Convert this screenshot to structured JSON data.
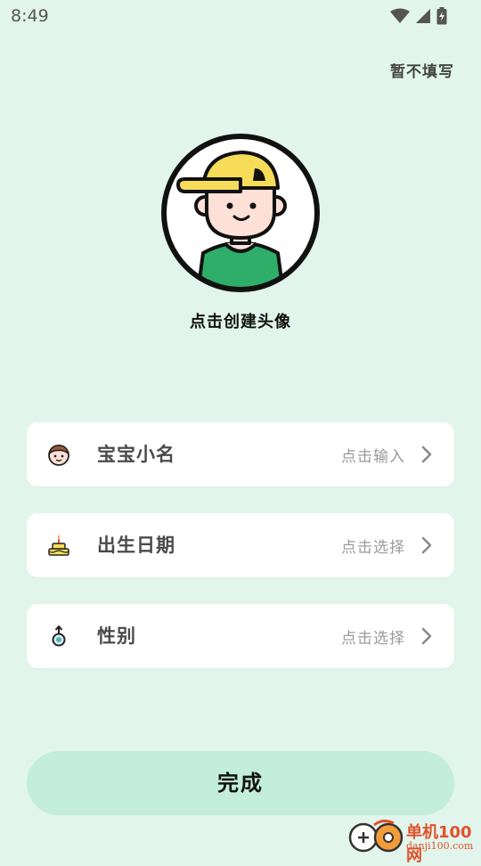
{
  "status_bar": {
    "time": "8:49",
    "icons": [
      "wifi-icon",
      "cell-signal-icon",
      "battery-charging-icon"
    ]
  },
  "header": {
    "skip_label": "暂不填写"
  },
  "avatar": {
    "caption": "点击创建头像",
    "icon": "boy-cap-avatar",
    "colors": {
      "cap": "#f7dc5a",
      "shirt": "#2fae6a",
      "skin": "#fde0d6",
      "ring": "#111111"
    }
  },
  "form": {
    "fields": [
      {
        "icon": "baby-face-icon",
        "label": "宝宝小名",
        "hint": "点击输入"
      },
      {
        "icon": "birthday-cake-icon",
        "label": "出生日期",
        "hint": "点击选择"
      },
      {
        "icon": "gender-icon",
        "label": "性别",
        "hint": "点击选择"
      }
    ]
  },
  "footer": {
    "done_label": "完成"
  },
  "watermark": {
    "title": "单机100网",
    "url": "danji100.com"
  },
  "colors": {
    "background": "#e1f5ec",
    "card": "#ffffff",
    "button": "#c2eedb",
    "hint_text": "#9a9a9a"
  }
}
